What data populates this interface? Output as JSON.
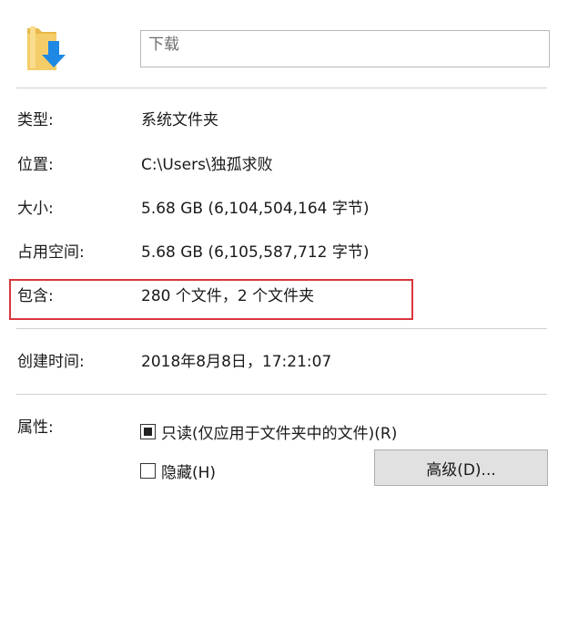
{
  "header": {
    "icon": "downloads-folder-icon",
    "name_value": "下载"
  },
  "properties": {
    "type": {
      "label": "类型:",
      "value": "系统文件夹"
    },
    "location": {
      "label": "位置:",
      "value": "C:\\Users\\独孤求败"
    },
    "size": {
      "label": "大小:",
      "value": "5.68 GB (6,104,504,164 字节)"
    },
    "size_on_disk": {
      "label": "占用空间:",
      "value": "5.68 GB (6,105,587,712 字节)"
    },
    "contains": {
      "label": "包含:",
      "value": "280 个文件，2 个文件夹"
    },
    "created": {
      "label": "创建时间:",
      "value": "2018年8月8日，17:21:07"
    }
  },
  "attributes": {
    "label": "属性:",
    "readonly_label": "只读(仅应用于文件夹中的文件)(R)",
    "readonly_state": "indeterminate",
    "hidden_label": "隐藏(H)",
    "hidden_state": "unchecked",
    "advanced_button": "高级(D)..."
  },
  "colors": {
    "highlight_border": "#d9363e",
    "divider": "#cfcfcf",
    "button_bg": "#e1e1e1",
    "folder_yellow": "#f2c55c",
    "arrow_blue": "#1e88e5"
  }
}
